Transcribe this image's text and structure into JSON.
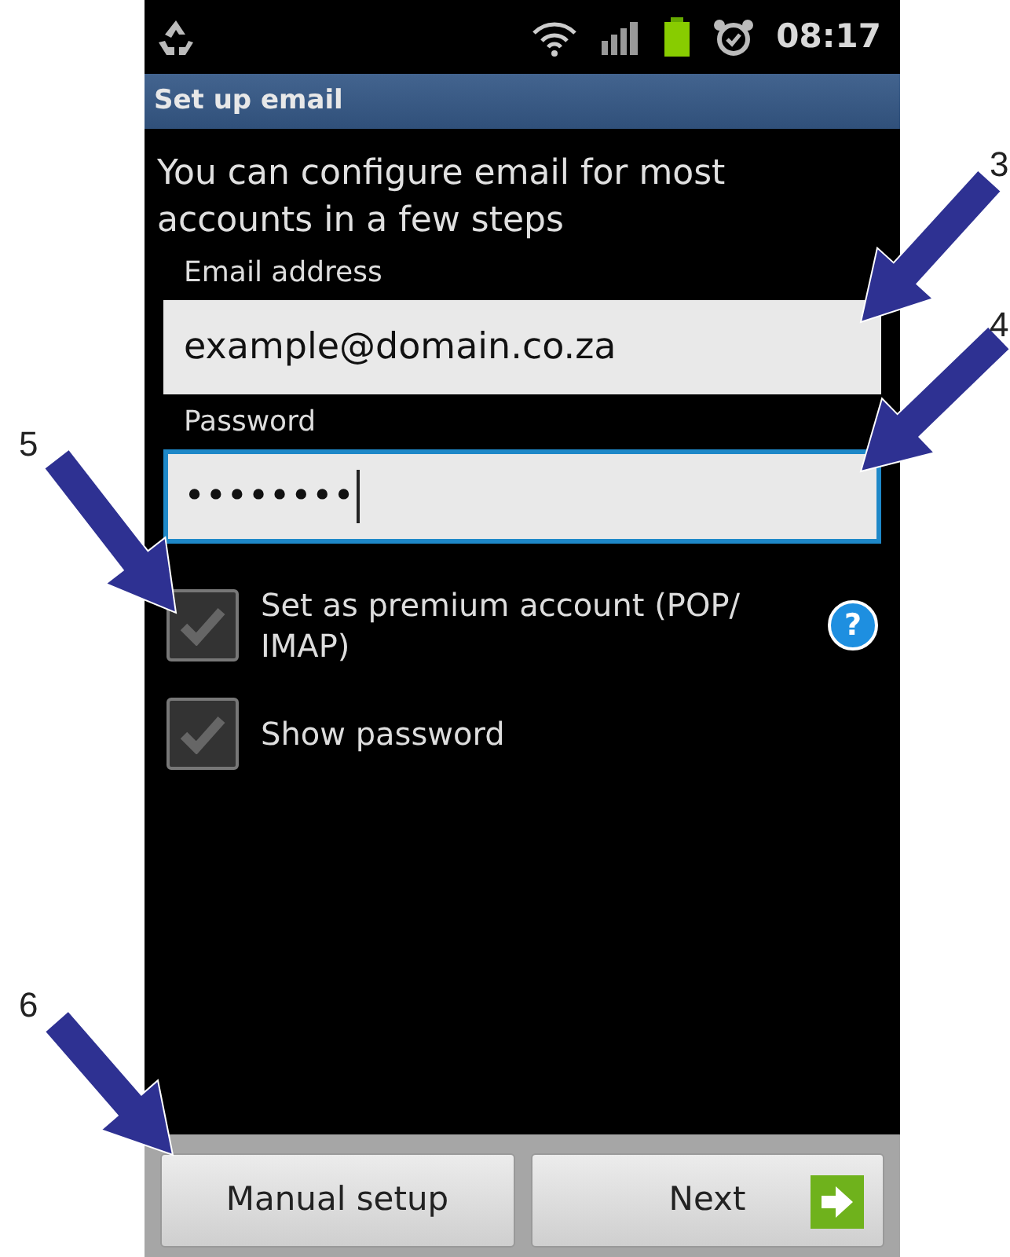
{
  "status_bar": {
    "time": "08:17"
  },
  "title_bar": {
    "title": "Set up email"
  },
  "intro": "You can configure email for most accounts in a few steps",
  "fields": [
    {
      "label": "Email address",
      "value": "example@domain.co.za",
      "focused": false
    },
    {
      "label": "Password",
      "value": "••••••••",
      "focused": true
    }
  ],
  "checkboxes": [
    {
      "label": "Set as premium account (POP/ IMAP)",
      "checked": false,
      "help": "?"
    },
    {
      "label": "Show password",
      "checked": false
    }
  ],
  "buttons": [
    {
      "label": "Manual setup",
      "kind": "plain"
    },
    {
      "label": "Next",
      "kind": "next"
    }
  ],
  "callouts": [
    {
      "number": "3"
    },
    {
      "number": "4"
    },
    {
      "number": "5"
    },
    {
      "number": "6"
    }
  ]
}
